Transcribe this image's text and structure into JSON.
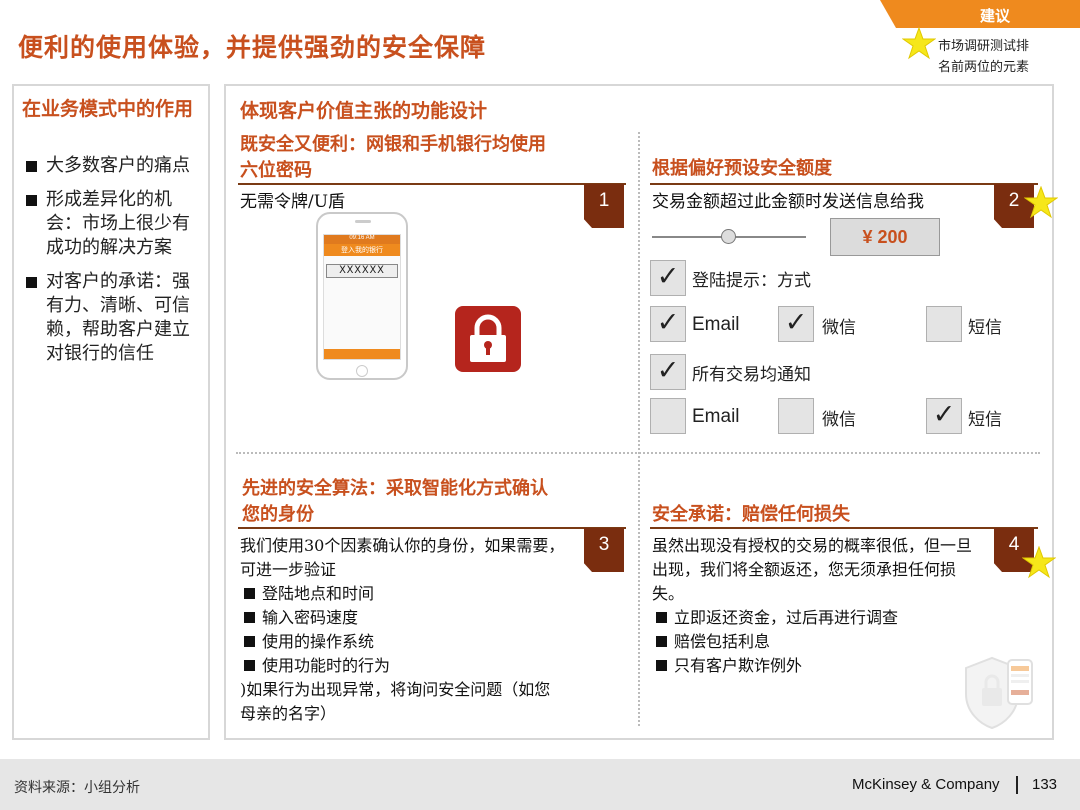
{
  "header": {
    "title": "便利的使用体验，并提供强劲的安全保障",
    "tag": "建议",
    "legend_line1": "市场调研测试排",
    "legend_line2": "名前两位的元素"
  },
  "left": {
    "heading": "在业务模式中的作用",
    "bullets": [
      "大多数客户的痛点",
      "形成差异化的机会：市场上很少有成功的解决方案",
      "对客户的承诺：强有力、清晰、可信赖，帮助客户建立对银行的信任"
    ]
  },
  "main": {
    "heading": "体现客户价值主张的功能设计",
    "s1": {
      "title_line1": "既安全又便利：网银和手机银行均使用",
      "title_line2": "六位密码",
      "num": "1",
      "text": "无需令牌/U盾",
      "phone_time": "09:16 AM",
      "phone_header": "登入我的银行",
      "phone_pin": "XXXXXX"
    },
    "s2": {
      "title": "根据偏好预设安全额度",
      "num": "2",
      "text": "交易金额超过此金额时发送信息给我",
      "amount": "¥ 200",
      "login_label": "登陆提示：方式",
      "all_label": "所有交易均通知",
      "opt_email": "Email",
      "opt_wechat": "微信",
      "opt_sms": "短信",
      "row1_checked": [
        true,
        true,
        false
      ],
      "row2_checked": [
        false,
        false,
        true
      ]
    },
    "s3": {
      "title_line1": "先进的安全算法：采取智能化方式确认",
      "title_line2": "您的身份",
      "num": "3",
      "intro": "我们使用30个因素确认你的身份，如果需要，可进一步验证",
      "items": [
        "登陆地点和时间",
        "输入密码速度",
        "使用的操作系统",
        "使用功能时的行为"
      ],
      "outro": ")如果行为出现异常，将询问安全问题（如您母亲的名字）"
    },
    "s4": {
      "title": "安全承诺：赔偿任何损失",
      "num": "4",
      "intro": "虽然出现没有授权的交易的概率很低，但一旦出现，我们将全额返还，您无须承担任何损失。",
      "items": [
        "立即返还资金，过后再进行调查",
        "赔偿包括利息",
        "只有客户欺诈例外"
      ]
    }
  },
  "footer": {
    "source": "资料来源：小组分析",
    "brand": "McKinsey & Company",
    "page": "133"
  },
  "colors": {
    "accent": "#c8501e",
    "dark_accent": "#7a2d0f",
    "tag": "#ef8a1e",
    "star": "#f6e71a"
  }
}
